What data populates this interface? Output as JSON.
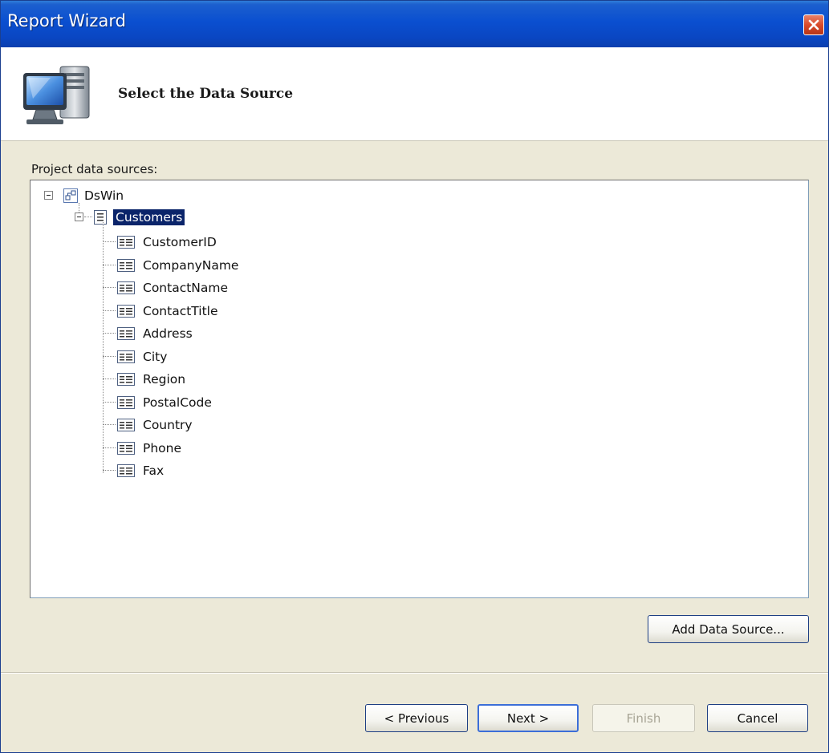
{
  "window": {
    "title": "Report Wizard",
    "close_icon": "close-icon"
  },
  "header": {
    "title": "Select the Data Source",
    "icon": "computer-monitor-icon"
  },
  "data_sources": {
    "label": "Project data sources:",
    "root": {
      "label": "DsWin",
      "icon": "dataset-icon",
      "expanded": true
    },
    "table": {
      "label": "Customers",
      "icon": "table-icon",
      "expanded": true,
      "selected": true
    },
    "fields": [
      {
        "label": "CustomerID"
      },
      {
        "label": "CompanyName"
      },
      {
        "label": "ContactName"
      },
      {
        "label": "ContactTitle"
      },
      {
        "label": "Address"
      },
      {
        "label": "City"
      },
      {
        "label": "Region"
      },
      {
        "label": "PostalCode"
      },
      {
        "label": "Country"
      },
      {
        "label": "Phone"
      },
      {
        "label": "Fax"
      }
    ],
    "field_icon": "field-icon"
  },
  "buttons": {
    "add_data_source": "Add Data Source...",
    "previous": "< Previous",
    "next": "Next >",
    "finish": "Finish",
    "cancel": "Cancel"
  }
}
